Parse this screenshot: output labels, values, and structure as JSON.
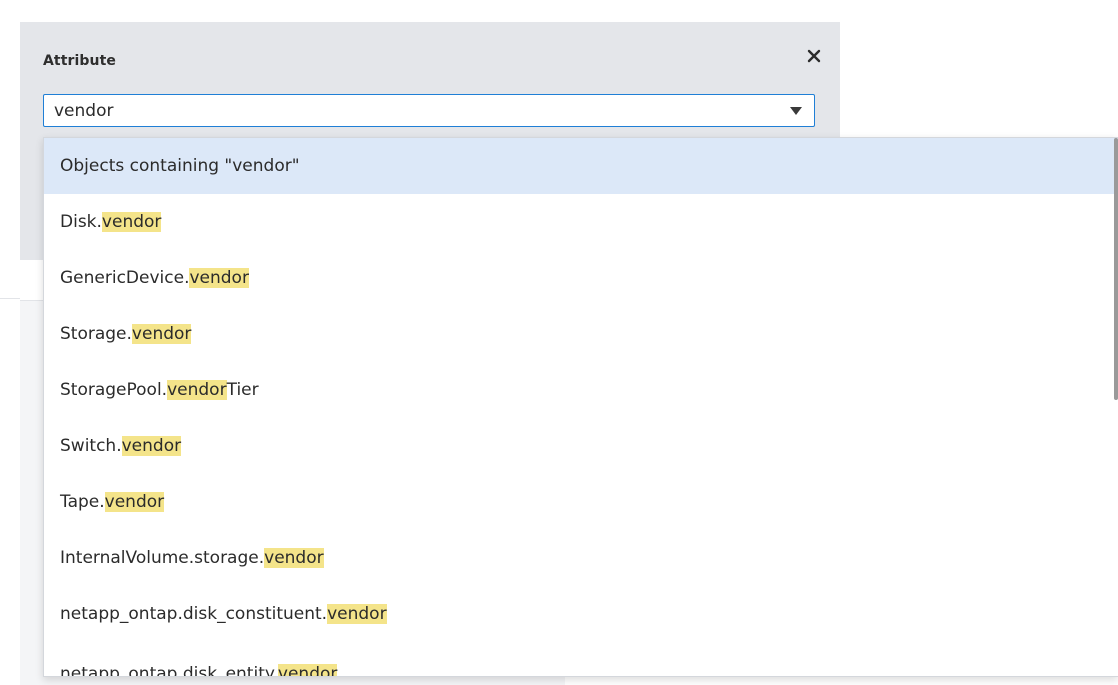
{
  "attribute_panel": {
    "label": "Attribute",
    "input_value": "vendor",
    "close_icon": "close-icon",
    "dropdown_icon": "chevron-down-icon"
  },
  "dropdown": {
    "header": "Objects containing \"vendor\"",
    "items": [
      {
        "prefix": "Disk.",
        "match": "vendor",
        "suffix": ""
      },
      {
        "prefix": "GenericDevice.",
        "match": "vendor",
        "suffix": ""
      },
      {
        "prefix": "Storage.",
        "match": "vendor",
        "suffix": ""
      },
      {
        "prefix": "StoragePool.",
        "match": "vendor",
        "suffix": "Tier"
      },
      {
        "prefix": "Switch.",
        "match": "vendor",
        "suffix": ""
      },
      {
        "prefix": "Tape.",
        "match": "vendor",
        "suffix": ""
      },
      {
        "prefix": "InternalVolume.storage.",
        "match": "vendor",
        "suffix": ""
      },
      {
        "prefix": "netapp_ontap.disk_constituent.",
        "match": "vendor",
        "suffix": ""
      },
      {
        "prefix": "netapp_ontap.disk_entity.",
        "match": "vendor",
        "suffix": ""
      }
    ]
  },
  "colors": {
    "panel_bg": "#e4e6ea",
    "input_border": "#1f7fd6",
    "selected_row": "#dce8f8",
    "highlight": "#f4e48a"
  }
}
